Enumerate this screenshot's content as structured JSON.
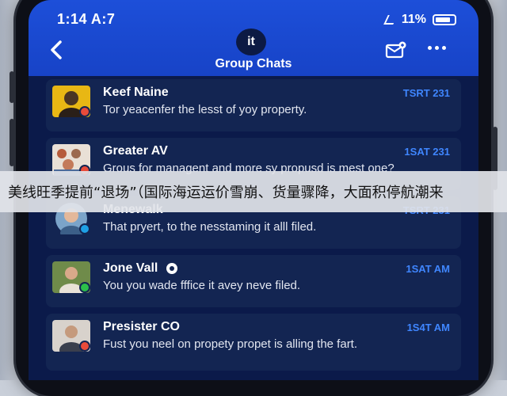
{
  "status_bar": {
    "time": "1:14 A:7",
    "battery": "11%"
  },
  "header": {
    "avatar_text": "it",
    "title": "Group Chats"
  },
  "chats": [
    {
      "name": "Keef Naine",
      "message": "Tor yeacenfer the lesst of yoy property.",
      "time": "TSRT 231",
      "avatar_color": "#e8b714",
      "badge_color": "#e84b3a"
    },
    {
      "name": "Greater AV",
      "message": "Grous for managent and more sy propusd is mest one?",
      "time": "1SAT 231",
      "avatar_color": "#b65b3a",
      "badge_color": "#e84b3a"
    },
    {
      "name": "Menewalk",
      "message": "That pryert, to the nesstaming it alll filed.",
      "time": "TSRT 231",
      "avatar_color": "#7ba4c9",
      "badge_color": "#1ea0e6"
    },
    {
      "name": "Jone Vall",
      "message": "You you wade fffice it avey neve filed.",
      "time": "1SAT AM",
      "avatar_color": "#6f8b4a",
      "badge_color": "#2cbf4a"
    },
    {
      "name": "Presister CO",
      "message": "Fust you neel on propety propet is alling the fart.",
      "time": "1S4T AM",
      "avatar_color": "#d8d2cc",
      "badge_color": "#e84b3a"
    }
  ],
  "banner": {
    "text": "美线旺季提前“退场”（国际海运运价雪崩、货量骤降，大面积停航潮来"
  }
}
